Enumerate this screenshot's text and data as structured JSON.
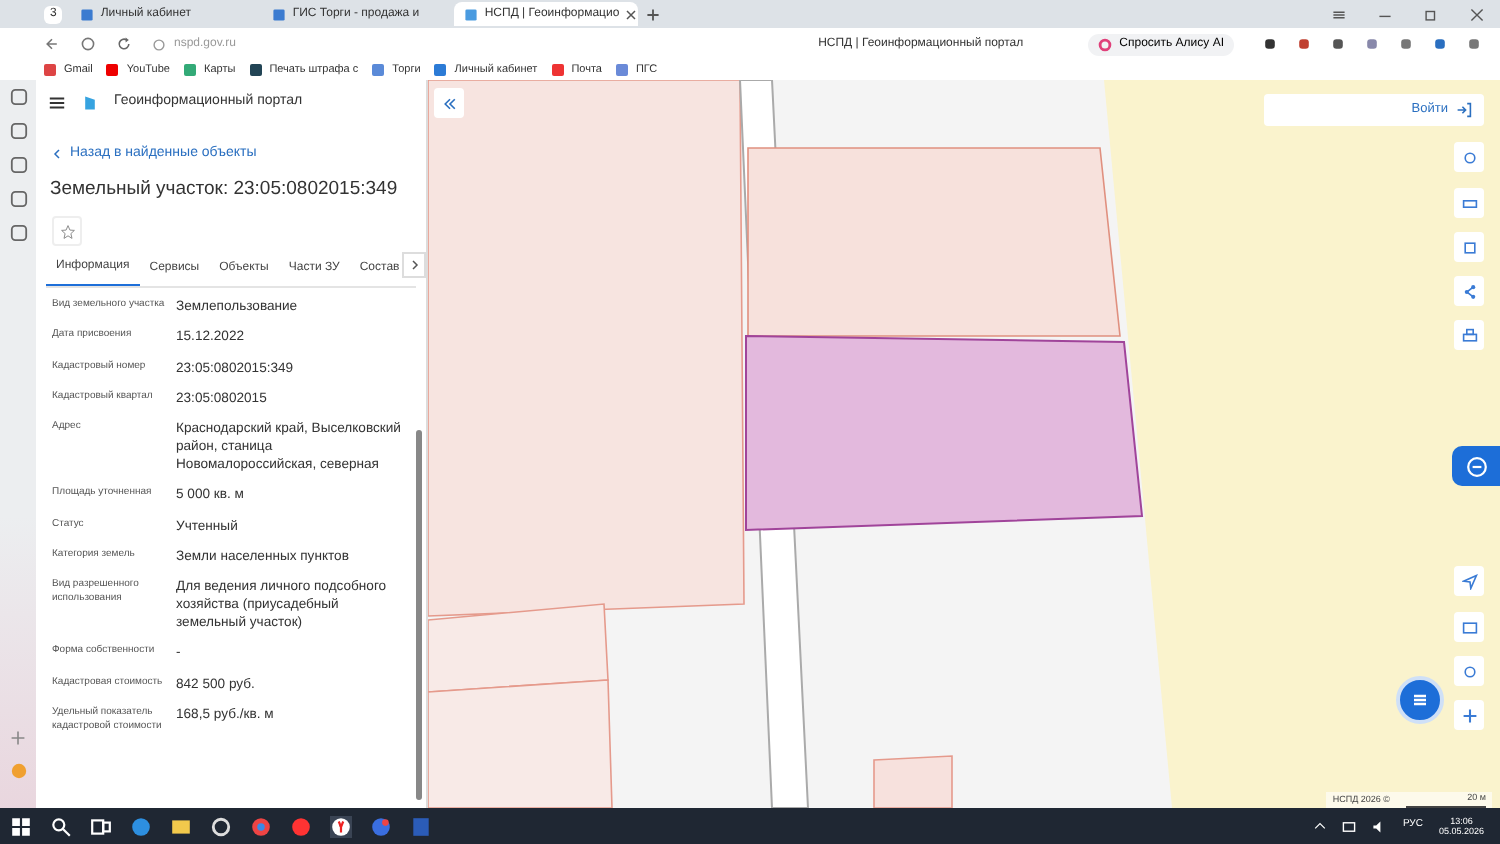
{
  "browser": {
    "tab_count": "3",
    "tabs": [
      {
        "label": "Личный кабинет",
        "selected": false
      },
      {
        "label": "ГИС Торги - продажа и",
        "selected": false
      },
      {
        "label": "НСПД | Геоинформацио",
        "selected": true
      }
    ],
    "address": "nspd.gov.ru",
    "page_title": "НСПД | Геоинформационный портал",
    "alice_button": "Спросить Алису AI",
    "bookmarks": [
      "Gmail",
      "YouTube",
      "Карты",
      "Печать штрафа с",
      "Торги",
      "Личный кабинет",
      "Почта",
      "ПГС"
    ]
  },
  "panel": {
    "portal_title": "Геоинформационный портал",
    "back_link": "Назад в найденные объекты",
    "heading": "Земельный участок: 23:05:0802015:349",
    "tabs": [
      {
        "label": "Информация",
        "selected": true
      },
      {
        "label": "Сервисы",
        "selected": false
      },
      {
        "label": "Объекты",
        "selected": false
      },
      {
        "label": "Части ЗУ",
        "selected": false
      },
      {
        "label": "Состав",
        "selected": false
      }
    ],
    "fields": [
      {
        "label": "Вид земельного участка",
        "value": "Землепользование"
      },
      {
        "label": "Дата присвоения",
        "value": "15.12.2022"
      },
      {
        "label": "Кадастровый номер",
        "value": "23:05:0802015:349"
      },
      {
        "label": "Кадастровый квартал",
        "value": "23:05:0802015"
      },
      {
        "label": "Адрес",
        "value": "Краснодарский край, Выселковский район, станица Новомалороссийская, северная"
      },
      {
        "label": "Площадь уточненная",
        "value": "5 000 кв. м"
      },
      {
        "label": "Статус",
        "value": "Учтенный"
      },
      {
        "label": "Категория земель",
        "value": "Земли населенных пунктов"
      },
      {
        "label": "Вид разрешенного использования",
        "value": "Для ведения личного подсобного хозяйства (приусадебный земельный участок)"
      },
      {
        "label": "Форма собственности",
        "value": "-"
      },
      {
        "label": "Кадастровая стоимость",
        "value": "842 500 руб."
      },
      {
        "label": "Удельный показатель кадастровой стоимости",
        "value": "168,5 руб./кв. м"
      }
    ]
  },
  "map": {
    "login_button": "Войти",
    "copyright": "НСПД 2026 ©",
    "scale": "20 м"
  },
  "taskbar": {
    "language": "РУС",
    "time": "13:06",
    "date": "05.05.2026"
  }
}
